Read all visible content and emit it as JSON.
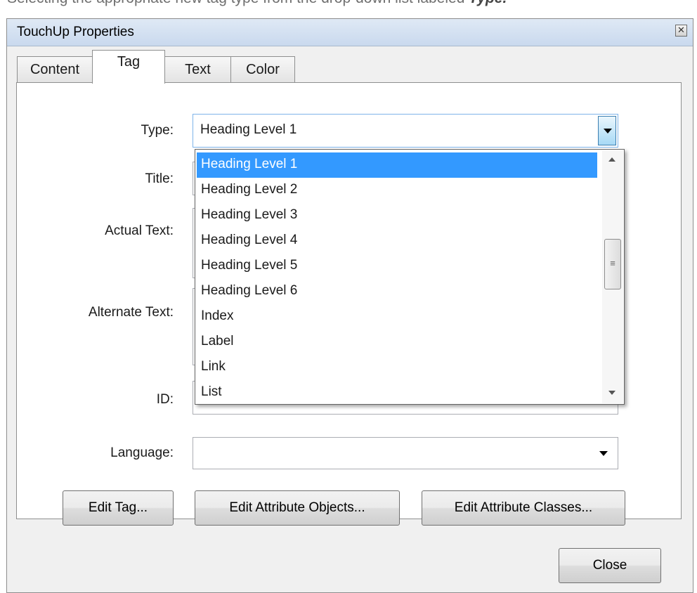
{
  "caption": {
    "text": "Selecting the appropriate new tag type from the drop-down list labeled ",
    "emphasis": "Type."
  },
  "dialog": {
    "title": "TouchUp Properties",
    "close_glyph": "✕"
  },
  "tabs": [
    {
      "label": "Content",
      "active": false
    },
    {
      "label": "Tag",
      "active": true
    },
    {
      "label": "Text",
      "active": false
    },
    {
      "label": "Color",
      "active": false
    }
  ],
  "form": {
    "type_label": "Type:",
    "type_value": "Heading Level 1",
    "title_label": "Title:",
    "actual_text_label": "Actual Text:",
    "alternate_text_label": "Alternate Text:",
    "id_label": "ID:",
    "language_label": "Language:",
    "language_value": ""
  },
  "dropdown": {
    "options": [
      "Heading Level 1",
      "Heading Level 2",
      "Heading Level 3",
      "Heading Level 4",
      "Heading Level 5",
      "Heading Level 6",
      "Index",
      "Label",
      "Link",
      "List"
    ],
    "selected": "Heading Level 1",
    "highlight_color": "#3399ff"
  },
  "buttons": {
    "edit_tag": "Edit Tag...",
    "edit_attribute_objects": "Edit Attribute Objects...",
    "edit_attribute_classes": "Edit Attribute Classes...",
    "close": "Close"
  }
}
